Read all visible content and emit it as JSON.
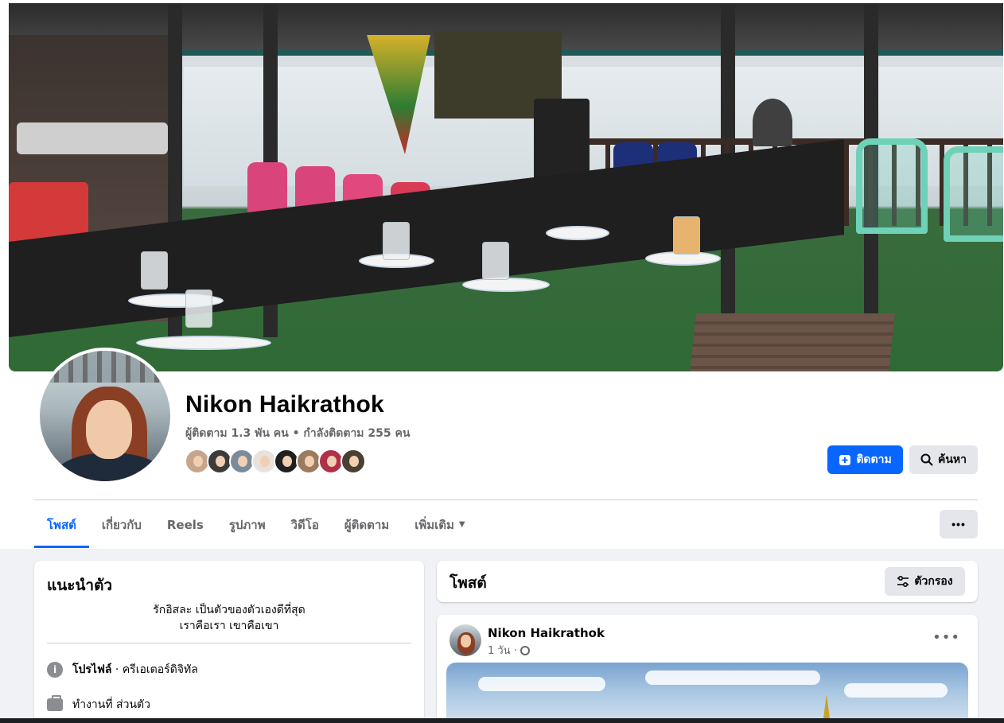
{
  "profile": {
    "name": "Nikon Haikrathok",
    "followers_text": "ผู้ติดตาม 1.3 พัน คน • กำลังติดตาม 255 คน"
  },
  "actions": {
    "follow_label": "ติดตาม",
    "search_label": "ค้นหา",
    "more_label": "•••"
  },
  "tabs": [
    {
      "label": "โพสต์"
    },
    {
      "label": "เกี่ยวกับ"
    },
    {
      "label": "Reels"
    },
    {
      "label": "รูปภาพ"
    },
    {
      "label": "วิดีโอ"
    },
    {
      "label": "ผู้ติดตาม"
    },
    {
      "label": "เพิ่มเติม"
    }
  ],
  "intro": {
    "title": "แนะนำตัว",
    "bio_line1": "รักอิสละ เป็นตัวของตัวเองดีที่สุด",
    "bio_line2": "เราคือเรา เขาคือเขา",
    "profile_label": "โปรไฟล์",
    "profile_value": " · ครีเอเตอร์ดิจิทัล",
    "work_text": "ทำงานที่ ส่วนตัว"
  },
  "posts": {
    "title": "โพสต์",
    "filter_label": "ตัวกรอง",
    "first_post": {
      "author": "Nikon Haikrathok",
      "time": "1 วัน ·"
    }
  },
  "colors": {
    "accent": "#0866ff",
    "background": "#f0f2f5",
    "secondary_text": "#65676b"
  }
}
